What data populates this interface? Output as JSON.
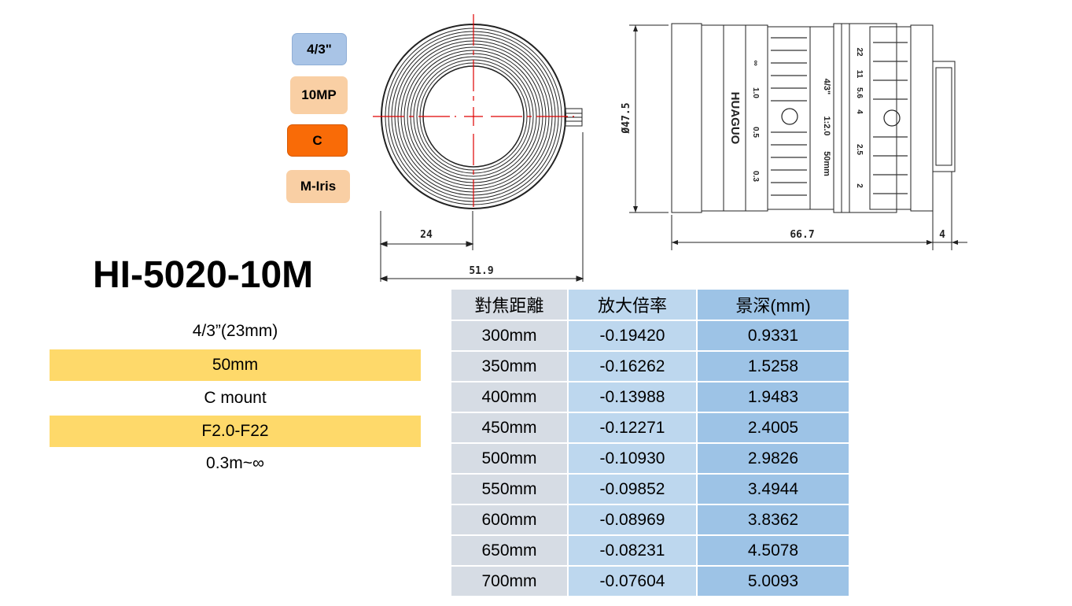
{
  "badges": {
    "sensor": "4/3\"",
    "resolution": "10MP",
    "mount": "C",
    "iris": "M-Iris"
  },
  "model": "HI-5020-10M",
  "specs": [
    "4/3”(23mm)",
    "50mm",
    "C mount",
    "F2.0-F22",
    "0.3m~∞"
  ],
  "drawing": {
    "front": {
      "dim_radius": "24",
      "dim_width": "51.9"
    },
    "side": {
      "diameter": "Ø47.5",
      "length": "66.7",
      "flange": "4",
      "brand": "HUAGUO",
      "focal": "50mm",
      "aperture_max": "1:2.0",
      "format": "4/3\"",
      "focus_marks": [
        "∞",
        "1.0",
        "0.5",
        "0.3"
      ],
      "fstop_marks": [
        "22",
        "11",
        "5.6",
        "4",
        "2.5",
        "2"
      ]
    }
  },
  "table": {
    "headers": [
      "對焦距離",
      "放大倍率",
      "景深(mm)"
    ],
    "rows": [
      [
        "300mm",
        "-0.19420",
        "0.9331"
      ],
      [
        "350mm",
        "-0.16262",
        "1.5258"
      ],
      [
        "400mm",
        "-0.13988",
        "1.9483"
      ],
      [
        "450mm",
        "-0.12271",
        "2.4005"
      ],
      [
        "500mm",
        "-0.10930",
        "2.9826"
      ],
      [
        "550mm",
        "-0.09852",
        "3.4944"
      ],
      [
        "600mm",
        "-0.08969",
        "3.8362"
      ],
      [
        "650mm",
        "-0.08231",
        "4.5078"
      ],
      [
        "700mm",
        "-0.07604",
        "5.0093"
      ]
    ]
  }
}
